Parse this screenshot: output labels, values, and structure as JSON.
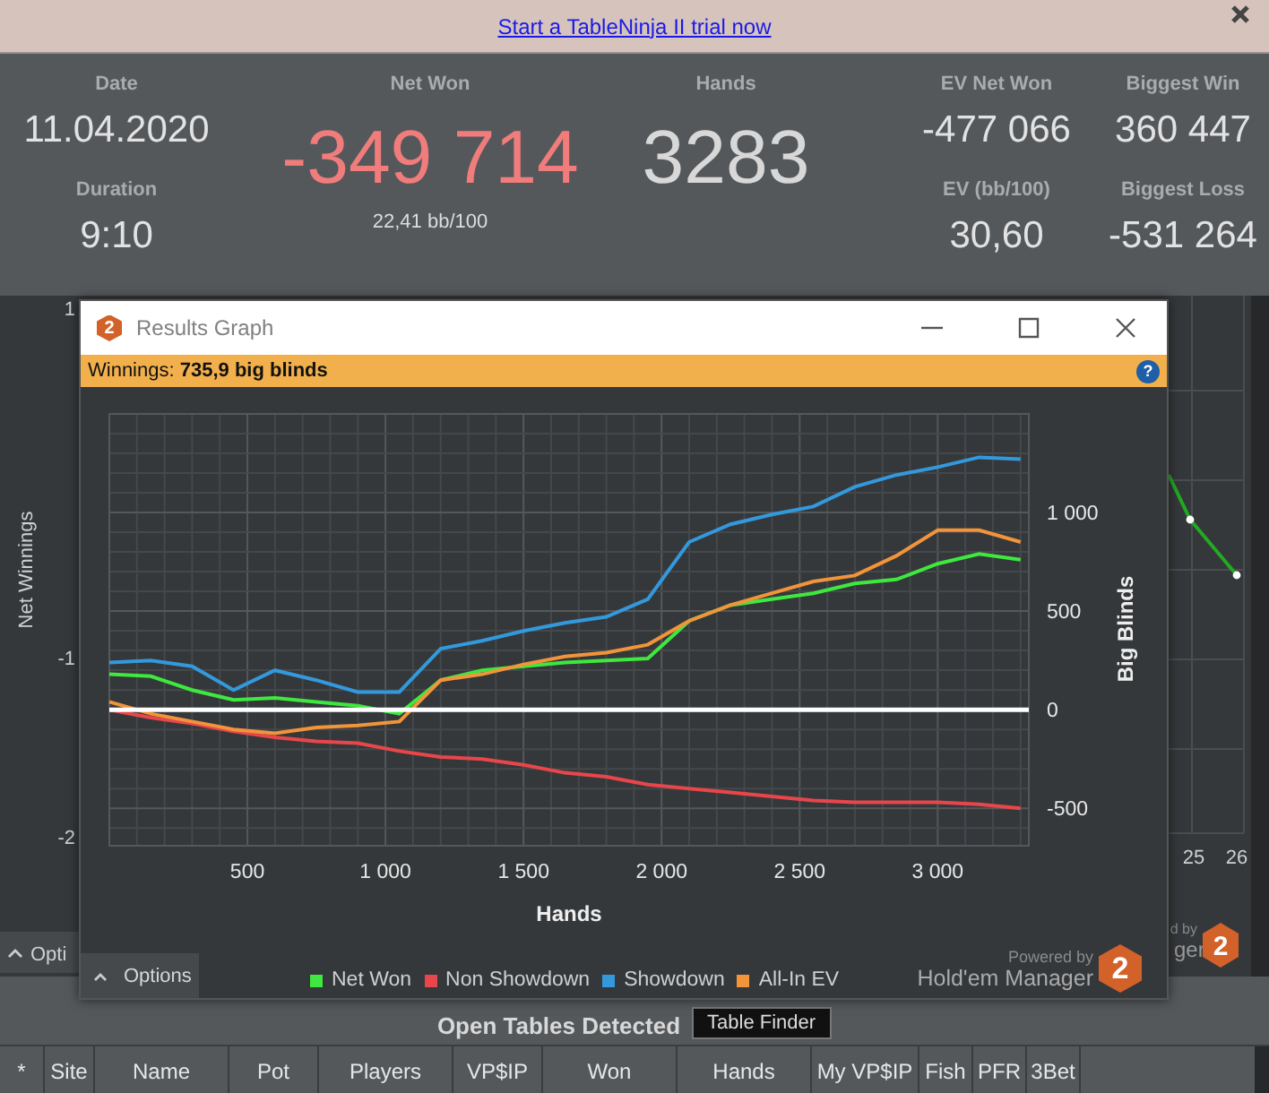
{
  "banner": {
    "link": "Start a TableNinja II trial now"
  },
  "stat_columns": [
    {
      "items": [
        {
          "label": "Date",
          "value": "11.04.2020",
          "kind": "normal"
        },
        {
          "label": "Duration",
          "value": "9:10",
          "kind": "normal"
        }
      ]
    },
    {
      "items": [
        {
          "label": "Net Won",
          "value": "-349 714",
          "kind": "alert",
          "note": "22,41 bb/100"
        }
      ]
    },
    {
      "items": [
        {
          "label": "Hands",
          "value": "3283",
          "kind": "big"
        }
      ]
    },
    {
      "items": [
        {
          "label": "EV Net Won",
          "value": "-477 066",
          "kind": "normal"
        },
        {
          "label": "EV (bb/100)",
          "value": "30,60",
          "kind": "normal"
        }
      ]
    },
    {
      "items": [
        {
          "label": "Biggest Win",
          "value": "360 447",
          "kind": "normal"
        },
        {
          "label": "Biggest Loss",
          "value": "-531 264",
          "kind": "normal"
        }
      ]
    }
  ],
  "background_graph": {
    "y_axis_title": "Net Winnings",
    "y_labels": [
      "1",
      "-1",
      "-2"
    ],
    "x_labels": [
      "25",
      "26"
    ],
    "options_button": "Opti",
    "branding": [
      "d by",
      "ger"
    ],
    "logo": "2"
  },
  "dialog": {
    "title": "Results Graph",
    "logo": "2",
    "winnings": "Winnings: **735,9 big blinds**",
    "help": "?",
    "chart_data": {
      "type": "line",
      "xlabel": "Hands",
      "ylabel": "Big Blinds",
      "x": [
        0,
        150,
        300,
        450,
        600,
        750,
        900,
        1050,
        1200,
        1350,
        1500,
        1650,
        1800,
        1950,
        2100,
        2250,
        2400,
        2550,
        2700,
        2850,
        3000,
        3150,
        3300
      ],
      "series": [
        {
          "name": "Net Won",
          "color": "#3ee83e",
          "values": [
            180,
            170,
            100,
            50,
            60,
            40,
            20,
            -20,
            150,
            200,
            220,
            240,
            250,
            260,
            450,
            530,
            560,
            590,
            640,
            660,
            740,
            790,
            760
          ]
        },
        {
          "name": "Non Showdown",
          "color": "#e8464a",
          "values": [
            0,
            -40,
            -70,
            -110,
            -140,
            -160,
            -170,
            -210,
            -240,
            -250,
            -280,
            -320,
            -340,
            -380,
            -400,
            -420,
            -440,
            -460,
            -470,
            -470,
            -470,
            -480,
            -500
          ]
        },
        {
          "name": "Showdown",
          "color": "#3399dd",
          "values": [
            240,
            250,
            220,
            100,
            200,
            150,
            90,
            90,
            310,
            350,
            400,
            440,
            470,
            560,
            850,
            940,
            990,
            1030,
            1130,
            1190,
            1230,
            1280,
            1270
          ]
        },
        {
          "name": "All-In EV",
          "color": "#f2943a",
          "values": [
            40,
            -20,
            -60,
            -100,
            -120,
            -90,
            -80,
            -60,
            150,
            180,
            230,
            270,
            290,
            330,
            450,
            530,
            590,
            650,
            680,
            780,
            910,
            910,
            850
          ]
        }
      ],
      "xlim": [
        0,
        3330
      ],
      "ylim": [
        -690,
        1500
      ],
      "grid": true,
      "xticks": [
        {
          "value": 500,
          "label": "500"
        },
        {
          "value": 1000,
          "label": "1 000"
        },
        {
          "value": 1500,
          "label": "1 500"
        },
        {
          "value": 2000,
          "label": "2 000"
        },
        {
          "value": 2500,
          "label": "2 500"
        },
        {
          "value": 3000,
          "label": "3 000"
        }
      ],
      "yticks": [
        {
          "value": -500,
          "label": "-500"
        },
        {
          "value": 0,
          "label": "0"
        },
        {
          "value": 500,
          "label": "500"
        },
        {
          "value": 1000,
          "label": "1 000"
        }
      ]
    },
    "options_button": "Options",
    "powered_by": "Powered by",
    "brand": "Hold'em Manager",
    "brand_logo": "2"
  },
  "open_tables": {
    "heading": "Open Tables Detected",
    "button": "Table Finder"
  },
  "table": {
    "columns": [
      "*",
      "Site",
      "Name",
      "Pot",
      "Players",
      "VP$IP",
      "Won",
      "Hands",
      "My VP$IP",
      "Fish",
      "PFR",
      "3Bet"
    ]
  }
}
